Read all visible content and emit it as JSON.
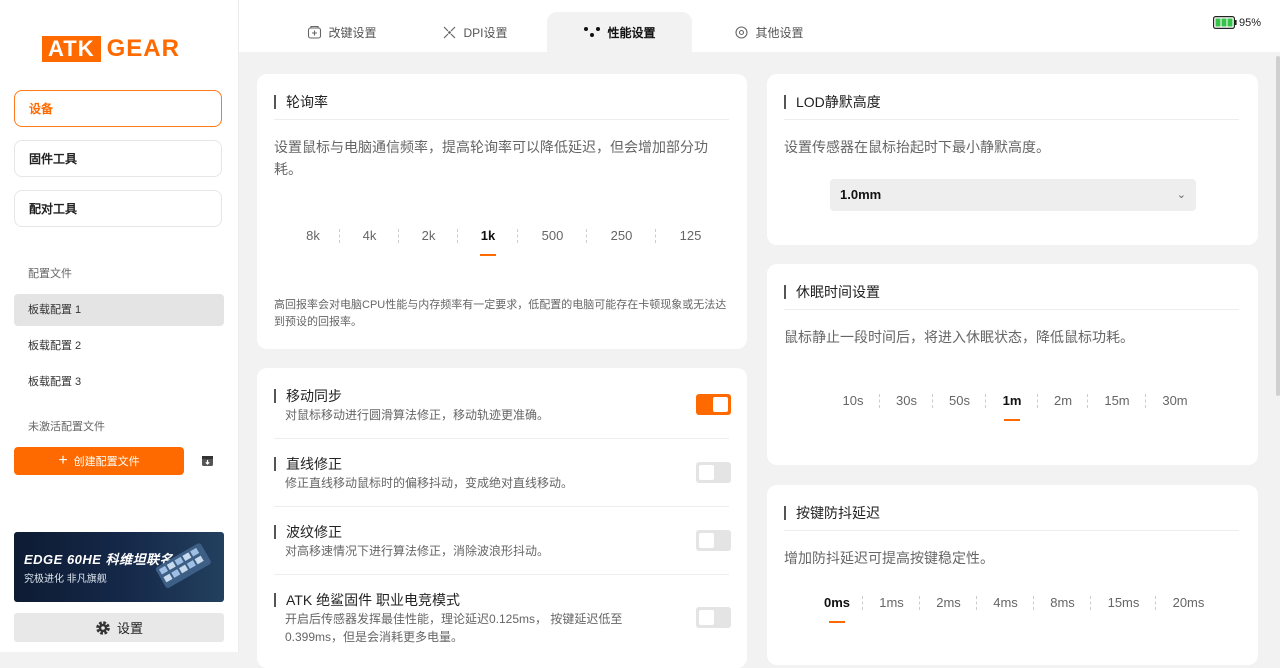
{
  "brand": {
    "logo_left": "ATK",
    "logo_right": "GEAR",
    "accent": "#ff6a00"
  },
  "sidebar": {
    "nav": [
      {
        "label": "设备",
        "active": true
      },
      {
        "label": "固件工具",
        "active": false
      },
      {
        "label": "配对工具",
        "active": false
      }
    ],
    "profiles_header": "配置文件",
    "profiles": [
      {
        "label": "板载配置 1",
        "active": true
      },
      {
        "label": "板载配置 2",
        "active": false
      },
      {
        "label": "板载配置 3",
        "active": false
      }
    ],
    "inactive_header": "未激活配置文件",
    "create_label": "创建配置文件",
    "banner": {
      "line1": "EDGE 60HE 科维坦联名",
      "line2": "究极进化 非凡旗舰"
    },
    "settings_label": "设置"
  },
  "tabs": [
    {
      "label": "改键设置",
      "icon": "keymap-icon",
      "active": false
    },
    {
      "label": "DPI设置",
      "icon": "dpi-icon",
      "active": false
    },
    {
      "label": "性能设置",
      "icon": "performance-icon",
      "active": true
    },
    {
      "label": "其他设置",
      "icon": "gear-icon",
      "active": false
    }
  ],
  "battery": {
    "percent": "95%",
    "level": 0.95
  },
  "polling": {
    "title": "轮询率",
    "desc": "设置鼠标与电脑通信频率，提高轮询率可以降低延迟，但会增加部分功耗。",
    "options": [
      "8k",
      "4k",
      "2k",
      "1k",
      "500",
      "250",
      "125"
    ],
    "selected": "1k",
    "note": "高回报率会对电脑CPU性能与内存频率有一定要求，低配置的电脑可能存在卡顿现象或无法达到预设的回报率。"
  },
  "toggles": [
    {
      "title": "移动同步",
      "desc": "对鼠标移动进行圆滑算法修正，移动轨迹更准确。",
      "on": true
    },
    {
      "title": "直线修正",
      "desc": "修正直线移动鼠标时的偏移抖动，变成绝对直线移动。",
      "on": false
    },
    {
      "title": "波纹修正",
      "desc": "对高移速情况下进行算法修正，消除波浪形抖动。",
      "on": false
    },
    {
      "title": "ATK 绝鲨固件 职业电竞模式",
      "desc_line1": "开启后传感器发挥最佳性能，理论延迟0.125ms， 按键延迟低至",
      "desc_line2": "0.399ms，但是会消耗更多电量。",
      "on": false
    }
  ],
  "lod": {
    "title": "LOD静默高度",
    "desc": "设置传感器在鼠标抬起时下最小静默高度。",
    "value": "1.0mm"
  },
  "sleep": {
    "title": "休眠时间设置",
    "desc": "鼠标静止一段时间后，将进入休眠状态，降低鼠标功耗。",
    "options": [
      "10s",
      "30s",
      "50s",
      "1m",
      "2m",
      "15m",
      "30m"
    ],
    "selected": "1m"
  },
  "debounce": {
    "title": "按键防抖延迟",
    "desc": "增加防抖延迟可提高按键稳定性。",
    "options": [
      "0ms",
      "1ms",
      "2ms",
      "4ms",
      "8ms",
      "15ms",
      "20ms"
    ],
    "selected": "0ms"
  }
}
